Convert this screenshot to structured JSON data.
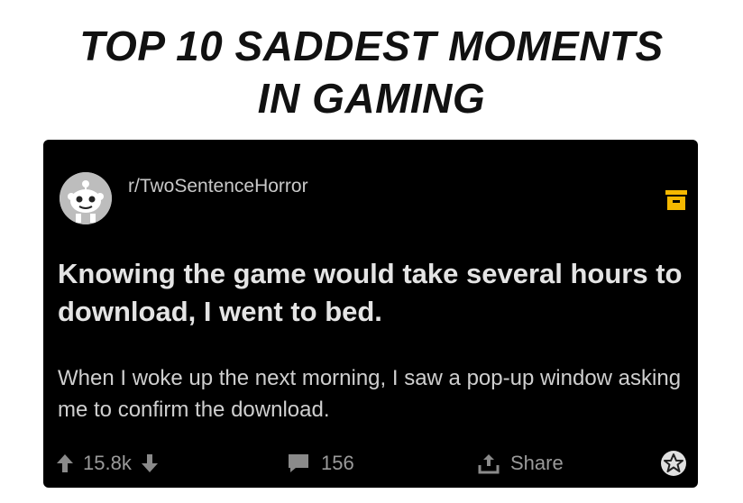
{
  "meme": {
    "title_line1": "TOP 10 SADDEST MOMENTS",
    "title_line2": "IN GAMING"
  },
  "post": {
    "subreddit": "r/TwoSentenceHorror",
    "title": "Knowing the game would take several hours to download, I went to bed.",
    "body": "When I woke up the next morning, I saw a pop-up window asking me to confirm the download.",
    "vote_count": "15.8k",
    "comment_count": "156",
    "share_label": "Share"
  },
  "colors": {
    "card_background": "#000000",
    "save_icon": "#f5b800",
    "text_primary": "#e4e4e4",
    "text_muted": "#9a9a9a"
  },
  "icons": [
    "reddit-avatar-icon",
    "save-icon",
    "upvote-icon",
    "downvote-icon",
    "comment-icon",
    "share-icon",
    "award-icon"
  ]
}
